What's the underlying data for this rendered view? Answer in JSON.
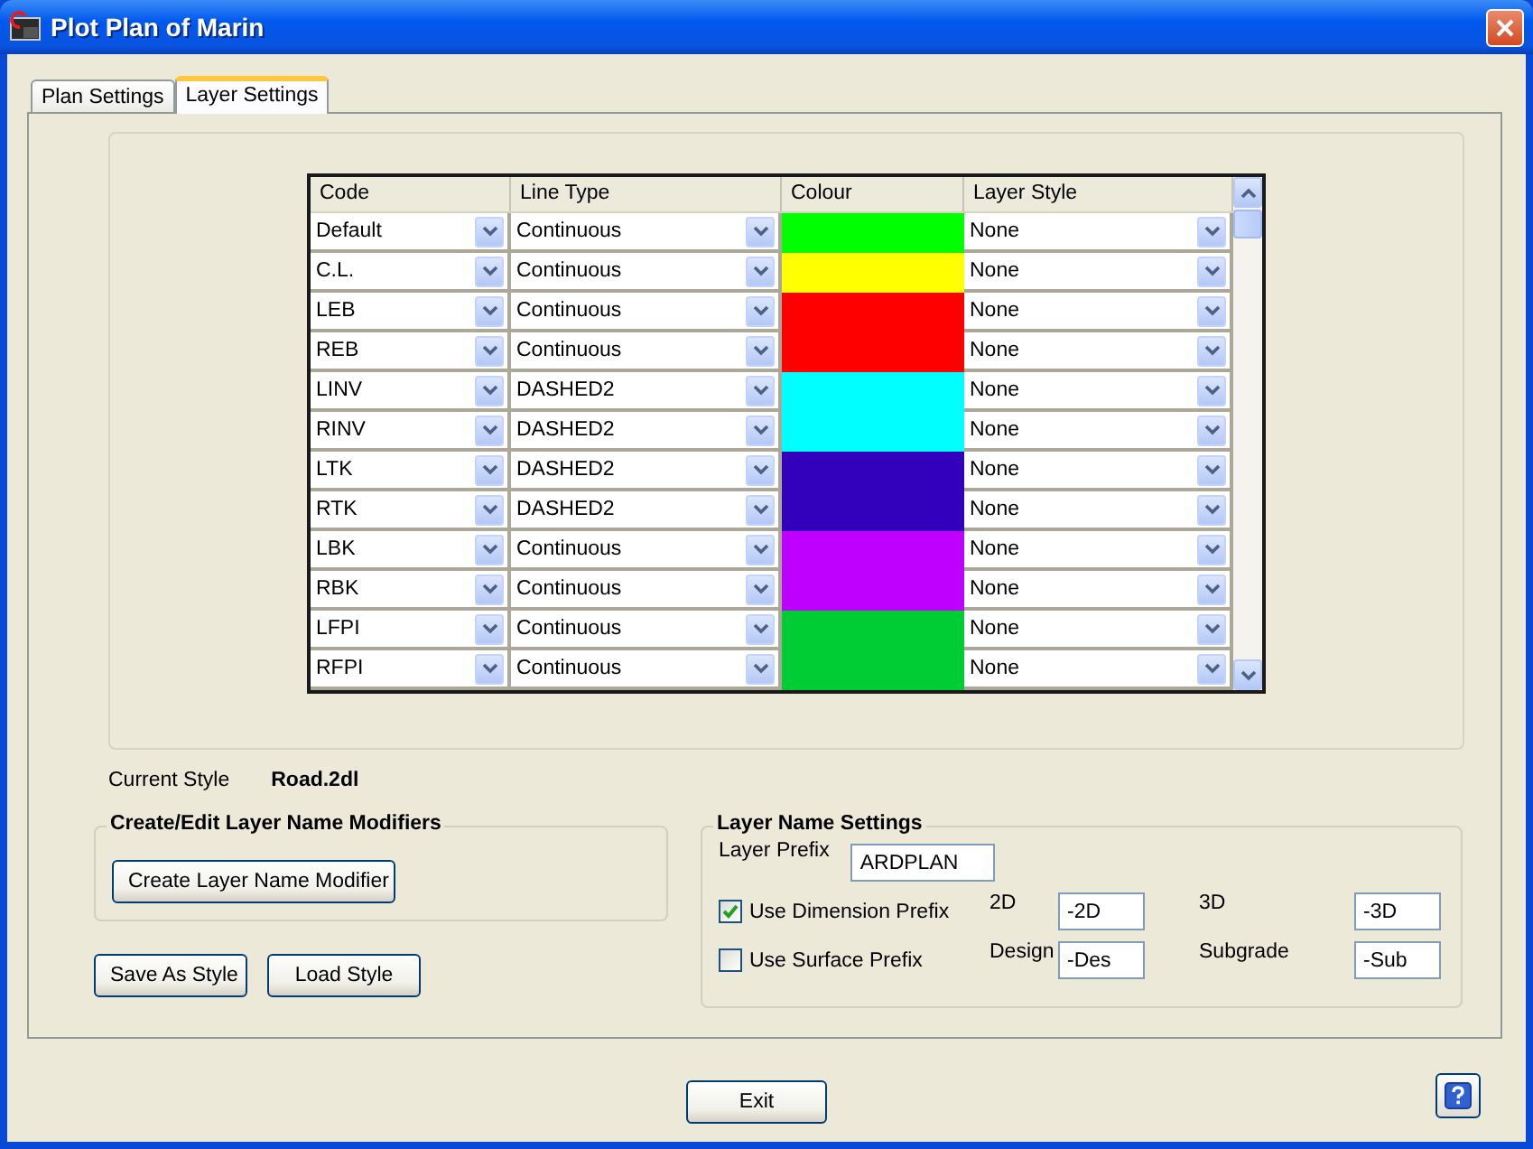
{
  "window": {
    "title": "Plot Plan of Marin"
  },
  "tabs": [
    {
      "label": "Plan Settings",
      "selected": false
    },
    {
      "label": "Layer Settings",
      "selected": true
    }
  ],
  "layer_table": {
    "columns": [
      "Code",
      "Line Type",
      "Colour",
      "Layer Style"
    ],
    "rows": [
      {
        "code": "Default",
        "line_type": "Continuous",
        "color": "#00ff00",
        "layer_style": "None"
      },
      {
        "code": "C.L.",
        "line_type": "Continuous",
        "color": "#ffff00",
        "layer_style": "None"
      },
      {
        "code": "LEB",
        "line_type": "Continuous",
        "color": "#ff0000",
        "layer_style": "None"
      },
      {
        "code": "REB",
        "line_type": "Continuous",
        "color": "#ff0000",
        "layer_style": "None"
      },
      {
        "code": "LINV",
        "line_type": "DASHED2",
        "color": "#00ffff",
        "layer_style": "None"
      },
      {
        "code": "RINV",
        "line_type": "DASHED2",
        "color": "#00ffff",
        "layer_style": "None"
      },
      {
        "code": "LTK",
        "line_type": "DASHED2",
        "color": "#3300bb",
        "layer_style": "None"
      },
      {
        "code": "RTK",
        "line_type": "DASHED2",
        "color": "#3300bb",
        "layer_style": "None"
      },
      {
        "code": "LBK",
        "line_type": "Continuous",
        "color": "#bf00ff",
        "layer_style": "None"
      },
      {
        "code": "RBK",
        "line_type": "Continuous",
        "color": "#bf00ff",
        "layer_style": "None"
      },
      {
        "code": "LFPI",
        "line_type": "Continuous",
        "color": "#00cc33",
        "layer_style": "None"
      },
      {
        "code": "RFPI",
        "line_type": "Continuous",
        "color": "#00cc33",
        "layer_style": "None"
      }
    ]
  },
  "current_style": {
    "label": "Current Style",
    "value": "Road.2dl"
  },
  "modifiers_group": {
    "title": "Create/Edit Layer Name Modifiers",
    "button": "Create Layer Name Modifier"
  },
  "style_buttons": [
    "Save As Style",
    "Load Style"
  ],
  "layer_name_settings": {
    "title": "Layer Name Settings",
    "prefix": {
      "label": "Layer Prefix",
      "value": "ARDPLAN"
    },
    "options": [
      {
        "label": "Use Dimension Prefix",
        "checked": true,
        "fields": [
          {
            "label": "2D",
            "value": "-2D"
          },
          {
            "label": "3D",
            "value": "-3D"
          }
        ]
      },
      {
        "label": "Use Surface Prefix",
        "checked": false,
        "fields": [
          {
            "label": "Design",
            "value": "-Des"
          },
          {
            "label": "Subgrade",
            "value": "-Sub"
          }
        ]
      }
    ]
  },
  "footer": {
    "exit_button": "Exit"
  }
}
